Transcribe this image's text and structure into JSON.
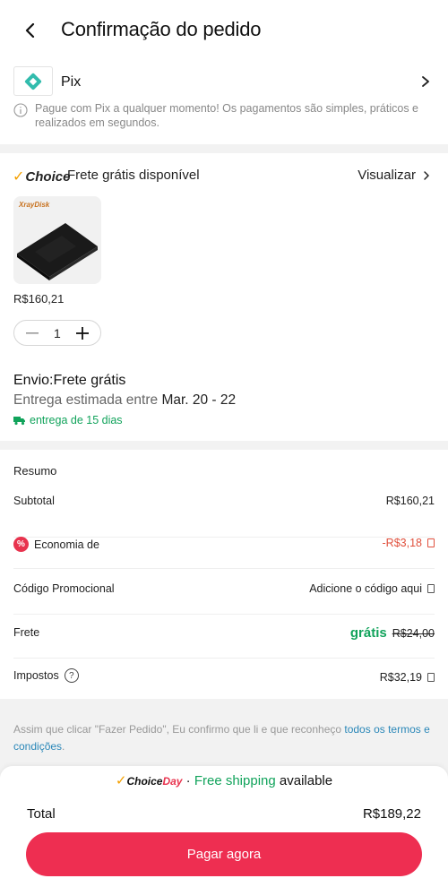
{
  "header": {
    "title": "Confirmação do pedido",
    "back_icon": "chevron-left-icon"
  },
  "payment": {
    "method": "Pix",
    "info": "Pague com Pix a qualquer momento! Os pagamentos são simples, práticos e realizados em segundos.",
    "brand_color": "#32BCAD"
  },
  "choice": {
    "logo": "Choice",
    "free_shipping": "Frete grátis disponível",
    "view_label": "Visualizar"
  },
  "product": {
    "brand_text": "XrayDisk",
    "price": "R$160,21",
    "quantity": "1"
  },
  "shipping": {
    "title": "Envio:Frete grátis",
    "estimate_label": "Entrega estimada entre",
    "estimate_dates": "Mar. 20 - 22",
    "days": "entrega de 15 dias"
  },
  "summary": {
    "title": "Resumo",
    "subtotal_label": "Subtotal",
    "subtotal_value": "R$160,21",
    "savings_label": "Economia de",
    "savings_value": "-R$3,18",
    "promo_label": "Código Promocional",
    "promo_value": "Adicione o código aqui",
    "shipping_label": "Frete",
    "shipping_free": "grátis",
    "shipping_old": "R$24,00",
    "tax_label": "Impostos",
    "tax_value": "R$32,19"
  },
  "legal": {
    "text": "Assim que clicar \"Fazer Pedido\", Eu confirmo que li e que reconheço ",
    "link": "todos os termos e condições",
    "end": "."
  },
  "footer": {
    "choiceday_a": "Choice",
    "choiceday_b": "Day",
    "promo_green": "Free shipping",
    "promo_rest": "available",
    "total_label": "Total",
    "total_value": "R$189,22",
    "pay_button": "Pagar agora"
  },
  "colors": {
    "accent": "#EE2E51",
    "green": "#11A35B",
    "choice": "#F4A000"
  }
}
